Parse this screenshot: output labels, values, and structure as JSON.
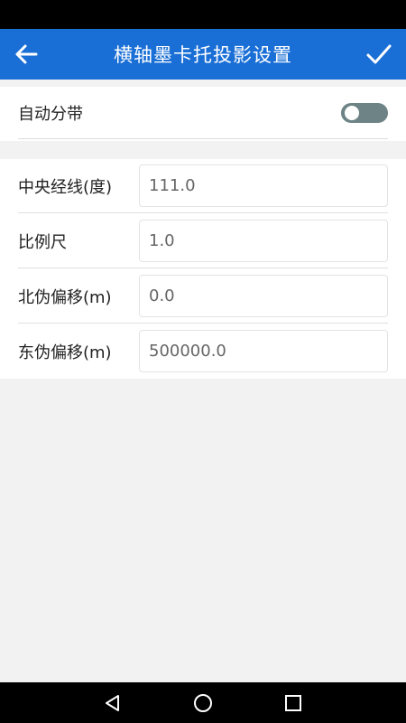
{
  "app_bar": {
    "title": "横轴墨卡托投影设置",
    "back_icon": "arrow-left-icon",
    "confirm_icon": "check-icon",
    "color": "#1a6fd6"
  },
  "auto_zone": {
    "label": "自动分带",
    "enabled": false
  },
  "params": [
    {
      "label": "中央经线(度)",
      "value": "111.0"
    },
    {
      "label": "比例尺",
      "value": "1.0"
    },
    {
      "label": "北伪偏移(m)",
      "value": "0.0"
    },
    {
      "label": "东伪偏移(m)",
      "value": "500000.0"
    }
  ],
  "nav_bar": {
    "back_icon": "triangle-back-icon",
    "home_icon": "circle-home-icon",
    "recents_icon": "square-recents-icon"
  }
}
